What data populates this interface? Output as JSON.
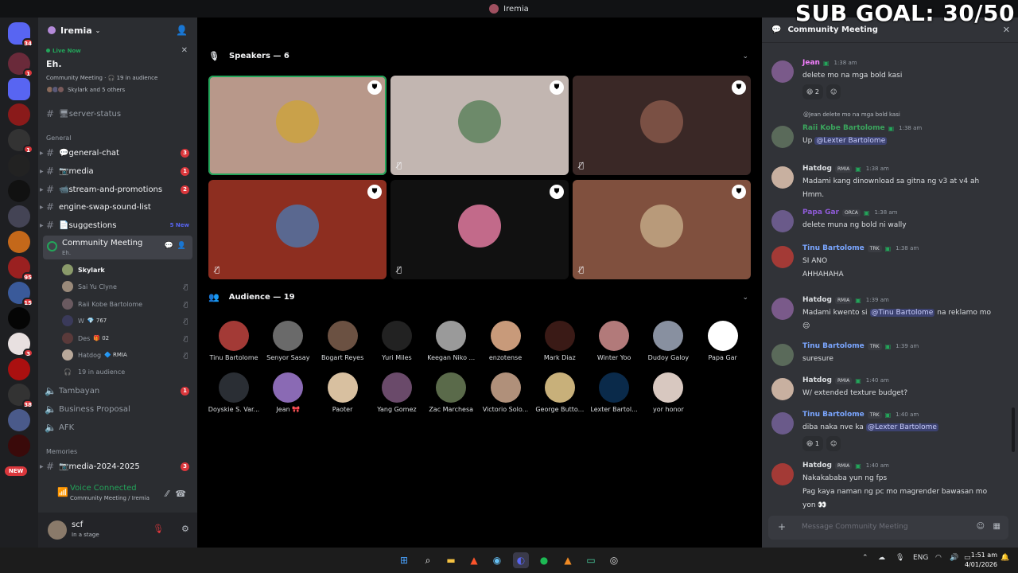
{
  "window": {
    "title": "Iremia"
  },
  "overlay": {
    "sub_goal": "SUB GOAL: 30/50"
  },
  "rail": {
    "badges": {
      "dm": "34",
      "s1": "1",
      "s4": "1",
      "s7": "95",
      "s8": "15",
      "s10": "3",
      "s12": "38"
    },
    "new_label": "NEW"
  },
  "sidebar": {
    "guild_name": "Iremia",
    "live": {
      "tag": "Live Now",
      "title": "Eh.",
      "meta": "Community Meeting · 🎧 19 in audience",
      "people": "Skylark and 5 others"
    },
    "channels": [
      {
        "name": "🖥server-status"
      },
      {
        "name": "💬general-chat",
        "badge": "3"
      },
      {
        "name": "📷media",
        "badge": "1"
      },
      {
        "name": "📹stream-and-promotions",
        "badge": "2"
      },
      {
        "name": "engine-swap-sound-list"
      },
      {
        "name": "📄suggestions",
        "new": "5 New"
      }
    ],
    "category_general": "General",
    "stage": {
      "name": "Community Meeting",
      "topic": "Eh."
    },
    "voice_users": [
      {
        "name": "Skylark",
        "tag": ""
      },
      {
        "name": "Sai Yu Clyne",
        "tag": ""
      },
      {
        "name": "Raii Kobe Bartolome",
        "tag": ""
      },
      {
        "name": "W",
        "tag": "💎 767"
      },
      {
        "name": "Des",
        "tag": "🎁 02"
      },
      {
        "name": "Hatdog",
        "tag": "🔷 RMIA"
      }
    ],
    "audience_count": "19 in audience",
    "other_channels": [
      {
        "name": "Tambayan",
        "badge": "1"
      },
      {
        "name": "Business Proposal"
      },
      {
        "name": "AFK"
      }
    ],
    "category_memories": "Memories",
    "memories_channel": {
      "name": "📷media-2024-2025",
      "badge": "3"
    },
    "voice_status": {
      "title": "Voice Connected",
      "detail": "Community Meeting / Iremia"
    },
    "user": {
      "name": "scf",
      "status": "In a stage"
    }
  },
  "stage": {
    "speakers_label": "Speakers — 6",
    "audience_label": "Audience — 19",
    "speaker_tiles": [
      {
        "bg": "#b8988a",
        "av": "#c9a14a",
        "highlight": true
      },
      {
        "bg": "#c2b6b1",
        "av": "#6d8a6a",
        "highlight": false
      },
      {
        "bg": "#3a2826",
        "av": "#7a5044",
        "highlight": false
      },
      {
        "bg": "#8d2e20",
        "av": "#5a6890",
        "highlight": false
      },
      {
        "bg": "#111111",
        "av": "#c26a8a",
        "highlight": false
      },
      {
        "bg": "#80503e",
        "av": "#b89a7a",
        "highlight": false
      }
    ],
    "audience": [
      {
        "name": "Tinu Bartolome",
        "color": "#a33a36"
      },
      {
        "name": "Senyor Sasay",
        "color": "#6a6a6a"
      },
      {
        "name": "Bogart Reyes",
        "color": "#6b5142"
      },
      {
        "name": "Yuri Miles",
        "color": "#222222"
      },
      {
        "name": "Keegan Niko ...",
        "color": "#9a9a9a"
      },
      {
        "name": "enzotense",
        "color": "#c89a7a"
      },
      {
        "name": "Mark Diaz",
        "color": "#3a1a16"
      },
      {
        "name": "Winter Yoo",
        "color": "#b27a7a"
      },
      {
        "name": "Dudoy Galoy",
        "color": "#8890a0"
      },
      {
        "name": "Papa Gar",
        "color": "#ffffff"
      },
      {
        "name": "Doyskie S. Var...",
        "color": "#2a2e34"
      },
      {
        "name": "Jean 🎀",
        "color": "#8a6ab4"
      },
      {
        "name": "Paoter",
        "color": "#d8c0a0"
      },
      {
        "name": "Yang Gomez",
        "color": "#6a4a6a"
      },
      {
        "name": "Zac Marchesa",
        "color": "#5a6a4a"
      },
      {
        "name": "Victorio Solo...",
        "color": "#b0907a"
      },
      {
        "name": "George Butto...",
        "color": "#c8b07a"
      },
      {
        "name": "Lexter Bartol...",
        "color": "#0a2a4a"
      },
      {
        "name": "yor honor",
        "color": "#d8c8c0"
      }
    ]
  },
  "chat": {
    "title": "Community Meeting",
    "messages": [
      {
        "name": "Jean",
        "name_color": "#f47fff",
        "time": "1:38 am",
        "lines": [
          "delete mo na mga bold kasi"
        ],
        "reaction": "😆 2"
      },
      {
        "reply": "@Jean delete mo na mga bold kasi",
        "name": "Raii Kobe Bartolome",
        "name_color": "#3ba55d",
        "time": "1:38 am",
        "lines": [
          "Up"
        ],
        "mention": "@Lexter Bartolome"
      },
      {
        "name": "Hatdog",
        "name_color": "#dbdee1",
        "tag": "RMIA",
        "time": "1:38 am",
        "lines": [
          "Madami kang dinownload sa gitna ng v3 at v4 ah",
          "Hmm."
        ]
      },
      {
        "name": "Papa Gar",
        "name_color": "#8f5bd8",
        "tag": "ORCA",
        "time": "1:38 am",
        "lines": [
          "delete muna ng bold ni wally"
        ]
      },
      {
        "name": "Tinu Bartolome",
        "name_color": "#7aa6ff",
        "tag": "TRK",
        "time": "1:38 am",
        "lines": [
          "SI ANO",
          "AHHAHAHA"
        ]
      },
      {
        "name": "Hatdog",
        "name_color": "#dbdee1",
        "tag": "RMIA",
        "time": "1:39 am",
        "lines": [
          "Madami kwento si",
          "na reklamo mo",
          "😌"
        ],
        "mention": "@Tinu Bartolome"
      },
      {
        "name": "Tinu Bartolome",
        "name_color": "#7aa6ff",
        "tag": "TRK",
        "time": "1:39 am",
        "lines": [
          "suresure"
        ]
      },
      {
        "name": "Hatdog",
        "name_color": "#dbdee1",
        "tag": "RMIA",
        "time": "1:40 am",
        "lines": [
          "W/ extended texture budget?"
        ]
      },
      {
        "name": "Tinu Bartolome",
        "name_color": "#7aa6ff",
        "tag": "TRK",
        "time": "1:40 am",
        "lines": [
          "diba naka nve ka"
        ],
        "mention": "@Lexter Bartolome",
        "reaction": "😆 1"
      },
      {
        "name": "Hatdog",
        "name_color": "#dbdee1",
        "tag": "RMIA",
        "time": "1:40 am",
        "lines": [
          "Nakakababa yun ng fps",
          "Pag kaya naman ng pc mo magrender bawasan mo",
          "yon 👀"
        ]
      }
    ],
    "input_placeholder": "Message Community Meeting"
  },
  "taskbar": {
    "lang": "ENG",
    "time": "1:51 am",
    "date": "4/01/2026"
  }
}
